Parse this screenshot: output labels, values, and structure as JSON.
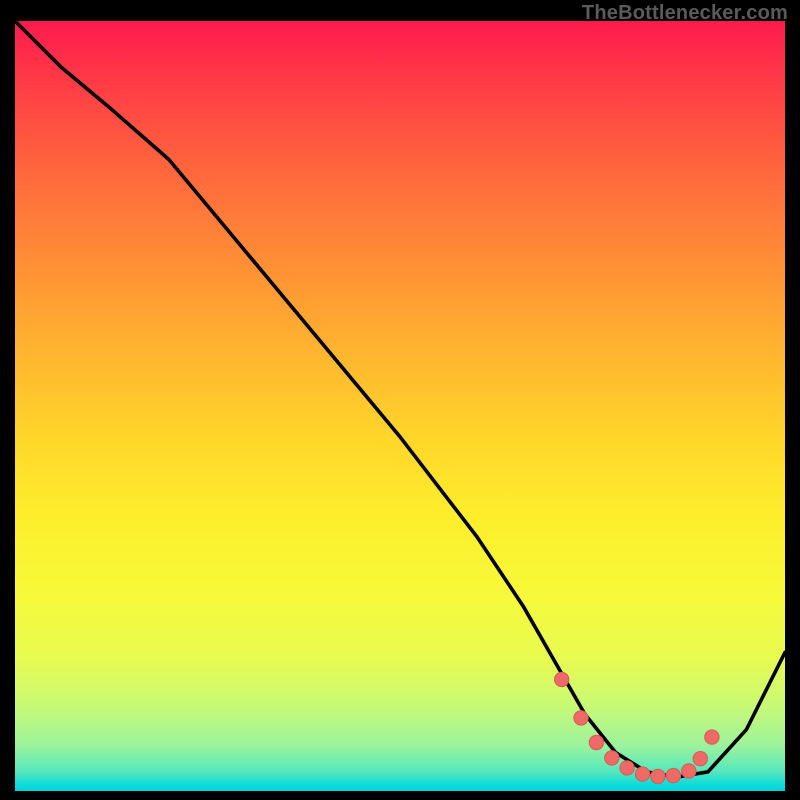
{
  "watermark": "TheBottlenecker.com",
  "chart_data": {
    "type": "line",
    "title": "",
    "xlabel": "",
    "ylabel": "",
    "xlim": [
      0,
      100
    ],
    "ylim": [
      0,
      100
    ],
    "grid": false,
    "series": [
      {
        "name": "bottleneck-curve",
        "x": [
          0,
          6,
          12,
          20,
          30,
          40,
          50,
          60,
          66,
          70,
          74,
          78,
          82,
          86,
          90,
          95,
          100
        ],
        "y": [
          100,
          94,
          89,
          82,
          70,
          58,
          46,
          33,
          24,
          17,
          10,
          5,
          2.5,
          1.8,
          2.5,
          8,
          18
        ]
      }
    ],
    "markers": {
      "name": "optimum-zone",
      "x": [
        71,
        73.5,
        75.5,
        77.5,
        79.5,
        81.5,
        83.5,
        85.5,
        87.5,
        89,
        90.5
      ],
      "y": [
        14.5,
        9.5,
        6.3,
        4.3,
        3,
        2.2,
        1.9,
        2,
        2.6,
        4.2,
        7
      ]
    },
    "gradient_colors": {
      "top": "#ff1a4d",
      "mid": "#ffd82a",
      "bottom": "#00d4e2"
    }
  }
}
